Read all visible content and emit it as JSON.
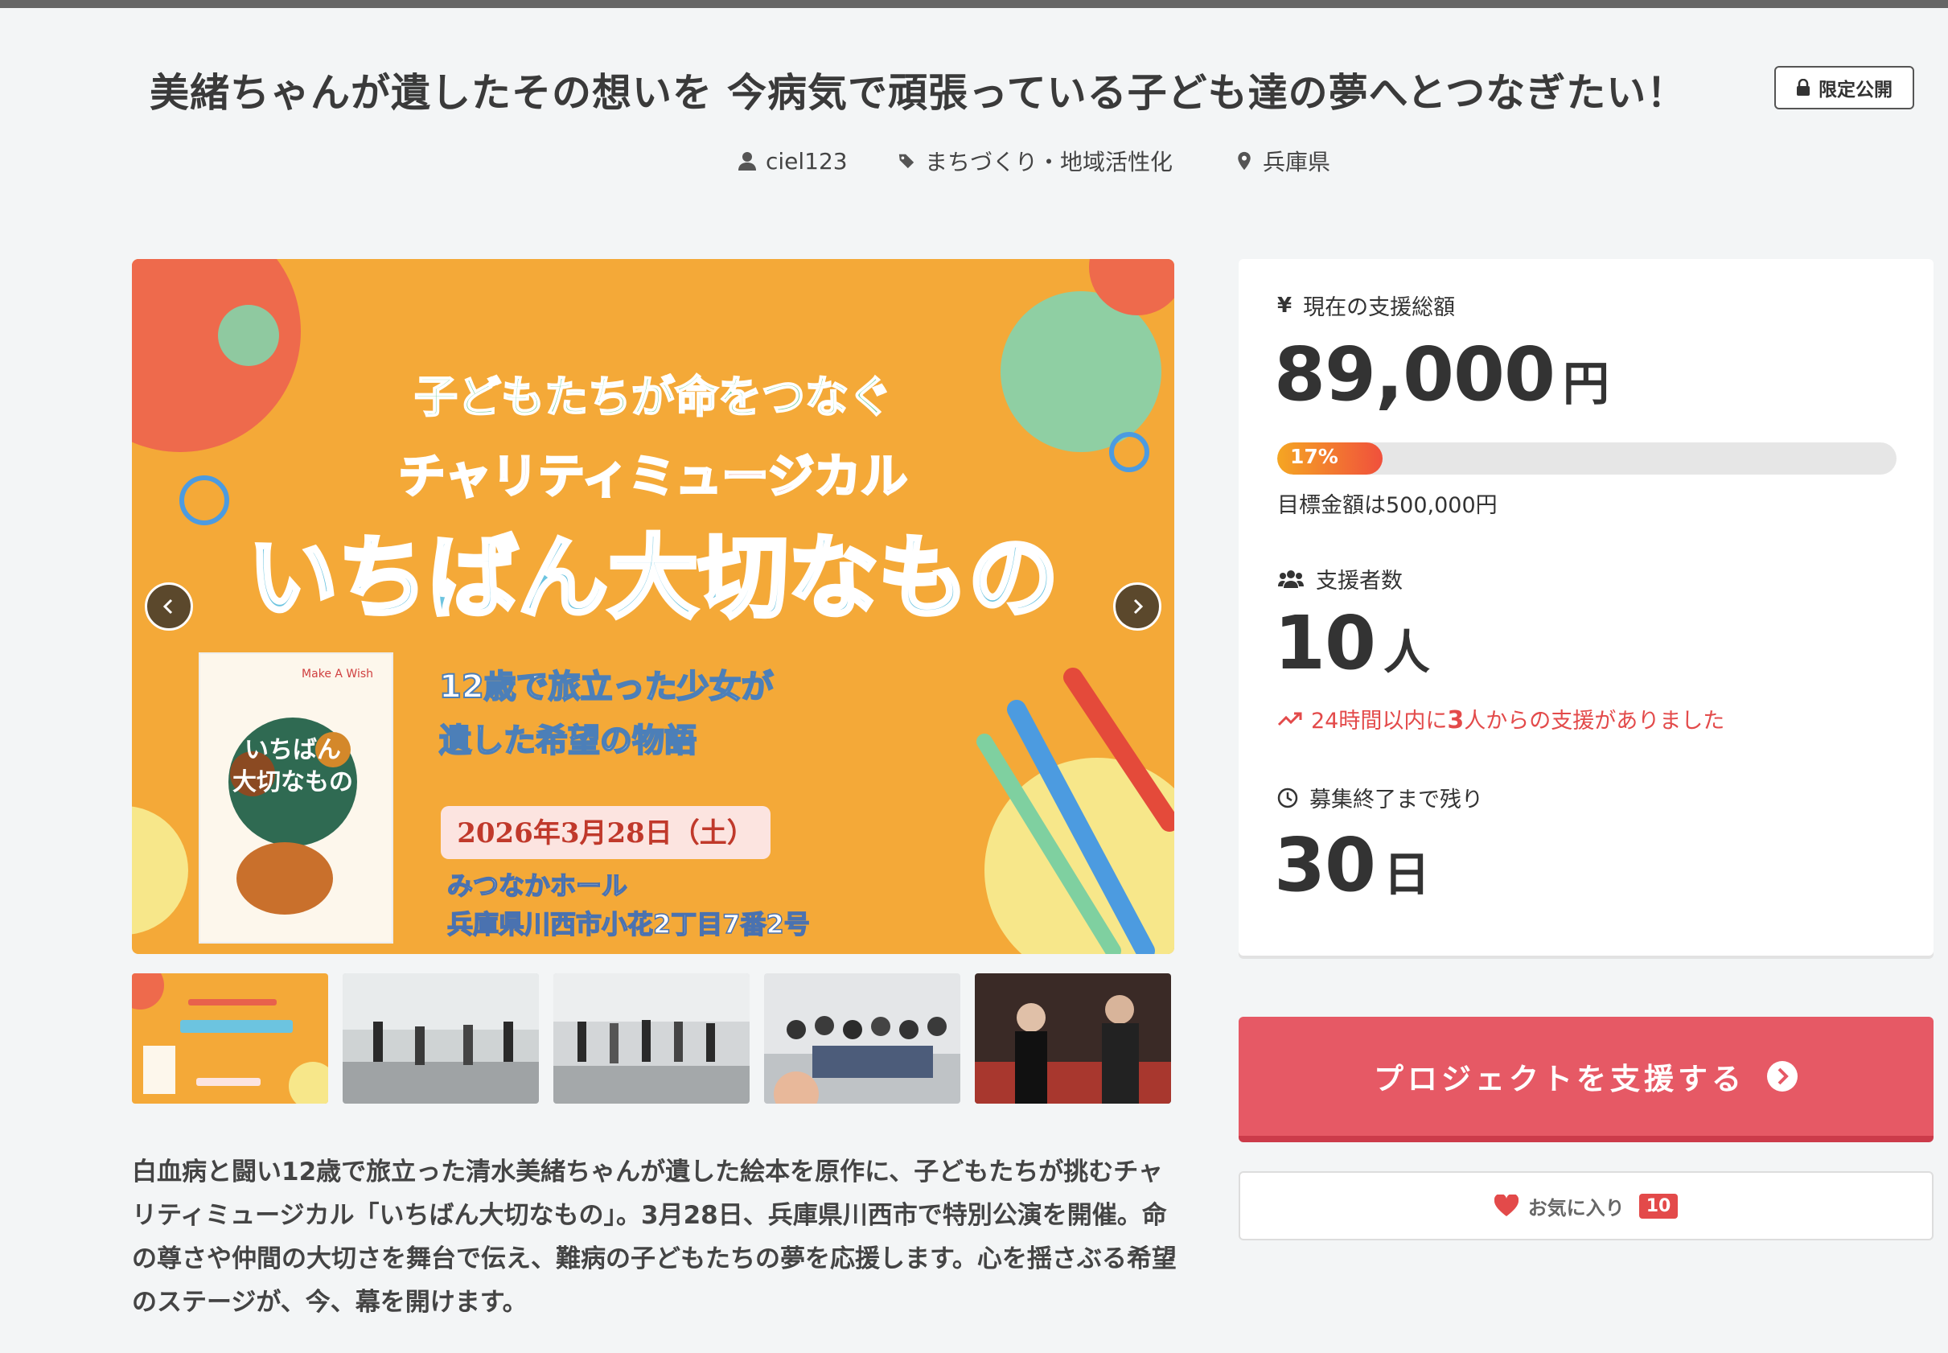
{
  "project": {
    "title": "美緒ちゃんが遺したその想いを 今病気で頑張っている子ども達の夢へとつなぎたい！",
    "visibility_badge": "限定公開",
    "author": "ciel123",
    "category": "まちづくり・地域活性化",
    "location": "兵庫県",
    "summary": "白血病と闘い12歳で旅立った清水美緒ちゃんが遺した絵本を原作に、子どもたちが挑むチャリティミュージカル「いちばん大切なもの」。3月28日、兵庫県川西市で特別公演を開催。命の尊さや仲間の大切さを舞台で伝え、難病の子どもたちの夢を応援します。心を揺さぶる希望のステージが、今、幕を開けます。"
  },
  "hero_image": {
    "arc_text": "子どもたちが命をつなぐ",
    "subtitle": "チャリティミュージカル",
    "main_title": "いちばん大切なもの",
    "tagline_1": "12歳で旅立った少女が",
    "tagline_2": "遺した希望の物語",
    "date": "2026年3月28日（土）",
    "venue": "みつなかホール",
    "address": "兵庫県川西市小花2丁目7番2号",
    "book_logo": "Make A Wish",
    "book_title_1": "いちばん",
    "book_title_2": "大切なもの"
  },
  "thumbnails": [
    {
      "name": "poster"
    },
    {
      "name": "rehearsal-1"
    },
    {
      "name": "rehearsal-2"
    },
    {
      "name": "group-photo"
    },
    {
      "name": "stage"
    }
  ],
  "stats": {
    "amount_label": "現在の支援総額",
    "amount_value": "89,000",
    "amount_unit": "円",
    "progress_percent": 17,
    "progress_text": "17%",
    "goal_text": "目標金額は500,000円",
    "supporters_label": "支援者数",
    "supporters_value": "10",
    "supporters_unit": "人",
    "recent_prefix": "24時間以内に",
    "recent_count": "3",
    "recent_suffix": "人からの支援がありました",
    "remaining_label": "募集終了まで残り",
    "remaining_value": "30",
    "remaining_unit": "日"
  },
  "actions": {
    "support_label": "プロジェクトを支援する",
    "favorite_label": "お気に入り",
    "favorite_count": "10"
  },
  "colors": {
    "accent": "#e65965",
    "progress_start": "#f5a623",
    "progress_end": "#f0503c",
    "poster_bg": "#f4a938"
  }
}
